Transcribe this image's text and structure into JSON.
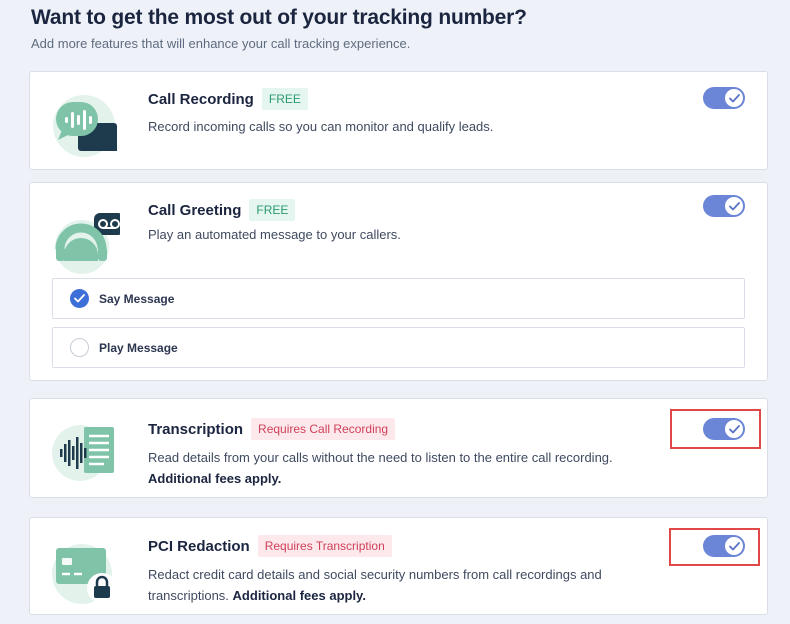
{
  "header": {
    "title": "Want to get the most out of your tracking number?",
    "subtitle": "Add more features that will enhance your call tracking experience."
  },
  "features": [
    {
      "title": "Call Recording",
      "badge": "FREE",
      "description": "Record incoming calls so you can monitor and qualify leads.",
      "enabled": true
    },
    {
      "title": "Call Greeting",
      "badge": "FREE",
      "description": "Play an automated message to your callers.",
      "enabled": true,
      "options": [
        {
          "label": "Say Message",
          "selected": true
        },
        {
          "label": "Play Message",
          "selected": false
        }
      ]
    },
    {
      "title": "Transcription",
      "badge": "Requires Call Recording",
      "description": "Read details from your calls without the need to listen to the entire call recording.",
      "fee": "Additional fees apply.",
      "enabled": true
    },
    {
      "title": "PCI Redaction",
      "badge": "Requires Transcription",
      "description": "Redact credit card details and social security numbers from call recordings and transcriptions.",
      "fee": "Additional fees apply.",
      "enabled": true
    }
  ],
  "colors": {
    "toggle_on": "#6b86d6",
    "badge_free": "#2a9a6e",
    "badge_required": "#d0405a",
    "highlight": "#e04848"
  },
  "icons": [
    "chat-bubble-waveform-icon",
    "voicemail-headset-icon",
    "audio-transcript-icon",
    "credit-card-lock-icon",
    "checkmark-icon"
  ]
}
